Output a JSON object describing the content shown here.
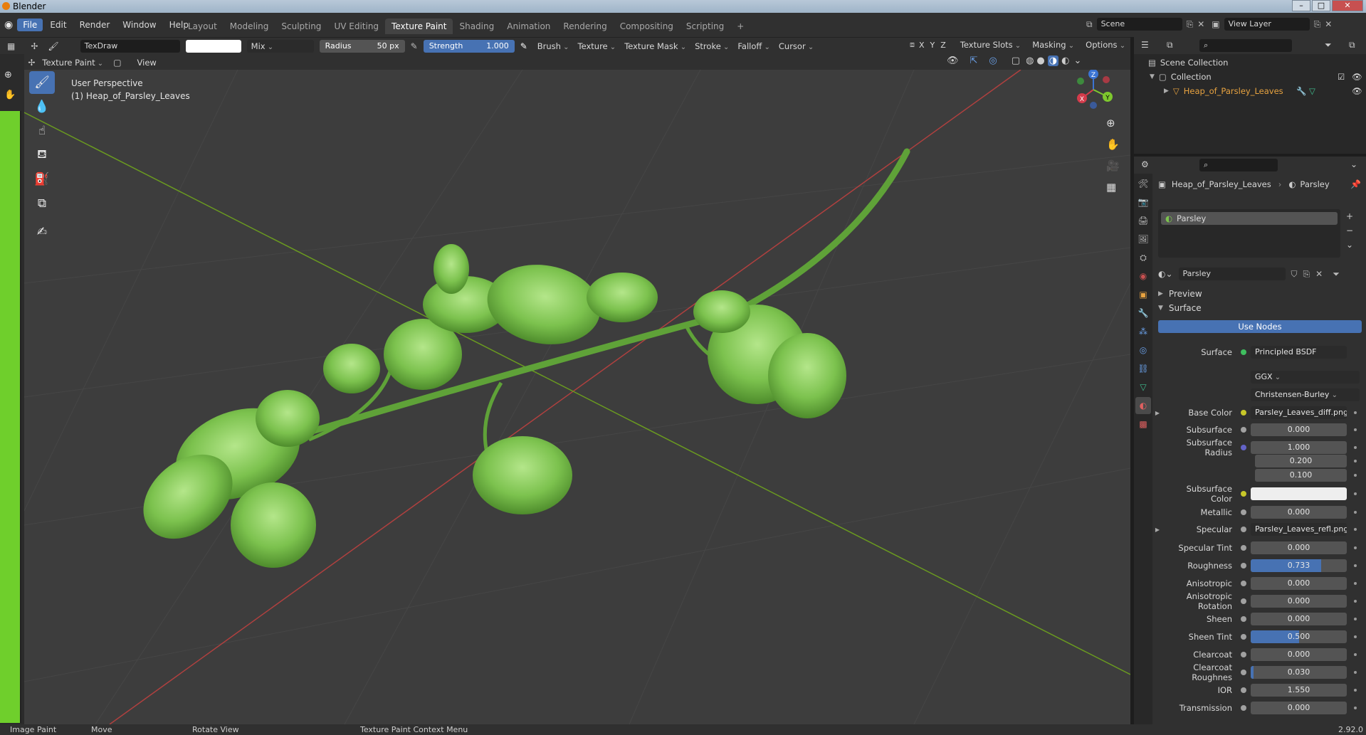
{
  "window": {
    "title": "Blender"
  },
  "menubar": {
    "menus": [
      "File",
      "Edit",
      "Render",
      "Window",
      "Help"
    ],
    "workspaces": [
      "Layout",
      "Modeling",
      "Sculpting",
      "UV Editing",
      "Texture Paint",
      "Shading",
      "Animation",
      "Rendering",
      "Compositing",
      "Scripting"
    ],
    "add_workspace": "+",
    "scene": "Scene",
    "view_layer": "View Layer"
  },
  "toolheader": {
    "brush_name": "TexDraw",
    "blend": "Mix",
    "radius_label": "Radius",
    "radius_value": "50 px",
    "strength_label": "Strength",
    "strength_value": "1.000",
    "menus": [
      "Brush",
      "Texture",
      "Texture Mask",
      "Stroke",
      "Falloff",
      "Cursor"
    ],
    "axes": [
      "X",
      "Y",
      "Z"
    ],
    "texture_slots": "Texture Slots",
    "masking": "Masking",
    "options": "Options"
  },
  "viewheader": {
    "mode": "Texture Paint",
    "view": "View"
  },
  "viewport": {
    "perspective": "User Perspective",
    "object": "(1) Heap_of_Parsley_Leaves",
    "gizmo_axes": [
      "X",
      "Y",
      "Z"
    ]
  },
  "outliner": {
    "scene_collection": "Scene Collection",
    "collection": "Collection",
    "object": "Heap_of_Parsley_Leaves"
  },
  "properties": {
    "breadcrumb_object": "Heap_of_Parsley_Leaves",
    "breadcrumb_material": "Parsley",
    "slot": "Parsley",
    "material_name": "Parsley",
    "panel_preview": "Preview",
    "panel_surface": "Surface",
    "use_nodes": "Use Nodes",
    "surface_label": "Surface",
    "surface_shader": "Principled BSDF",
    "distribution": "GGX",
    "subsurface_method": "Christensen-Burley",
    "rows": [
      {
        "label": "Base Color",
        "value": "Parsley_Leaves_diff.png",
        "kind": "text",
        "socket": "yellow",
        "expand": true
      },
      {
        "label": "Subsurface",
        "value": "0.000",
        "kind": "num",
        "fill": 0
      },
      {
        "label": "Subsurface Radius",
        "value": "1.000",
        "kind": "num",
        "fill": 0,
        "socket": "purple"
      },
      {
        "label": "",
        "value": "0.200",
        "kind": "num",
        "fill": 0,
        "nosocket": true
      },
      {
        "label": "",
        "value": "0.100",
        "kind": "num",
        "fill": 0,
        "nosocket": true
      },
      {
        "label": "Subsurface Color",
        "value": "",
        "kind": "color",
        "socket": "yellow"
      },
      {
        "label": "Metallic",
        "value": "0.000",
        "kind": "num",
        "fill": 0
      },
      {
        "label": "Specular",
        "value": "Parsley_Leaves_refl.png",
        "kind": "text",
        "expand": true
      },
      {
        "label": "Specular Tint",
        "value": "0.000",
        "kind": "num",
        "fill": 0
      },
      {
        "label": "Roughness",
        "value": "0.733",
        "kind": "num",
        "fill": 0.733
      },
      {
        "label": "Anisotropic",
        "value": "0.000",
        "kind": "num",
        "fill": 0
      },
      {
        "label": "Anisotropic Rotation",
        "value": "0.000",
        "kind": "num",
        "fill": 0
      },
      {
        "label": "Sheen",
        "value": "0.000",
        "kind": "num",
        "fill": 0
      },
      {
        "label": "Sheen Tint",
        "value": "0.500",
        "kind": "num",
        "fill": 0.5
      },
      {
        "label": "Clearcoat",
        "value": "0.000",
        "kind": "num",
        "fill": 0
      },
      {
        "label": "Clearcoat Roughnes",
        "value": "0.030",
        "kind": "num",
        "fill": 0.03
      },
      {
        "label": "IOR",
        "value": "1.550",
        "kind": "num",
        "fill": 0
      },
      {
        "label": "Transmission",
        "value": "0.000",
        "kind": "num",
        "fill": 0
      }
    ]
  },
  "statusbar": {
    "item1": "Image Paint",
    "item2": "Move",
    "item3": "Rotate View",
    "item4": "Texture Paint Context Menu",
    "version": "2.92.0"
  },
  "colors": {
    "accent": "#4772b3",
    "selected_object": "#e8a340",
    "grid_x": "#b0403f",
    "grid_y": "#6a9a20"
  }
}
